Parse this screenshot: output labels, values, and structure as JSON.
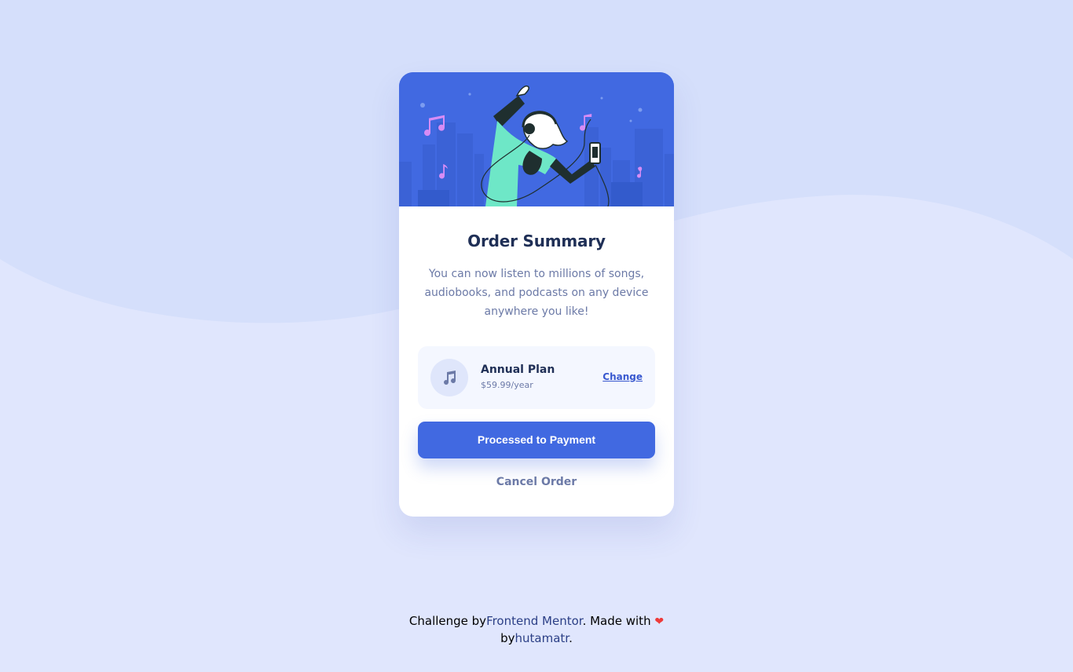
{
  "card": {
    "title": "Order Summary",
    "description": "You can now listen to millions of songs, audiobooks, and podcasts on any device anywhere you like!",
    "plan": {
      "icon": "music-note-icon",
      "name": "Annual Plan",
      "price": "$59.99/year",
      "change_label": "Change"
    },
    "primary_button": "Processed to Payment",
    "secondary_button": "Cancel Order"
  },
  "footer": {
    "prefix": "Challenge by",
    "link1": "Frontend Mentor",
    "middle": ". Made with",
    "heart_icon": "heart-icon",
    "line2_prefix": "by",
    "link2": "hutamatr",
    "end": "."
  },
  "colors": {
    "background": "#e0e6fd",
    "wave": "#d5dffb",
    "primary": "#4169e1",
    "title": "#1f2f56",
    "muted": "#6c7aa7",
    "heart": "#ee3a3a"
  }
}
